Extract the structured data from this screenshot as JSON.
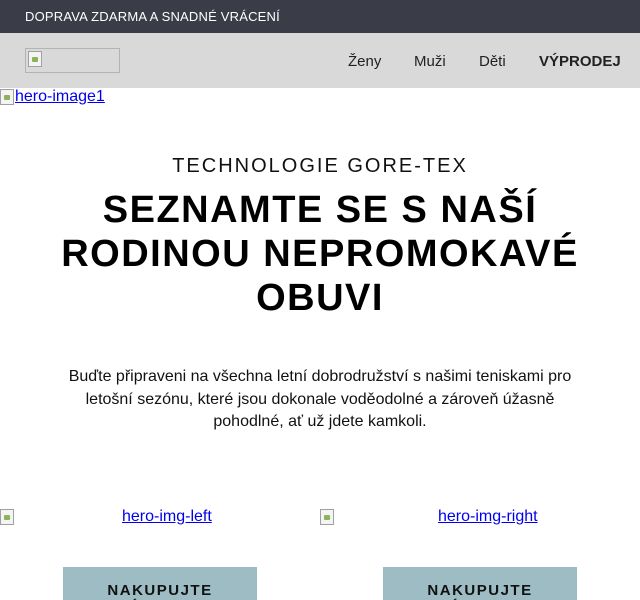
{
  "topbar": {
    "text": "DOPRAVA ZDARMA A SNADNÉ VRÁCENÍ"
  },
  "nav": {
    "items": [
      "Ženy",
      "Muži",
      "Děti"
    ],
    "sale": "VÝPRODEJ"
  },
  "hero": {
    "image_alt": "hero-image1",
    "eyebrow": "TECHNOLOGIE GORE-TEX",
    "headline": "SEZNAMTE SE S NAŠÍ RODINOU NEPROMOKAVÉ OBUVI",
    "lead": "Buďte připraveni na všechna letní dobrodružství s našimi teniskami pro letošní sezónu, které jsou dokonale voděodolné a zároveň úžasně pohodlné, ať už jdete kamkoli."
  },
  "promo": {
    "left_alt": "hero-img-left",
    "right_alt": "hero-img-right",
    "left_button": "NAKUPUJTE DÁMSKOU",
    "right_button": "NAKUPUJTE PÁNSKOU"
  }
}
